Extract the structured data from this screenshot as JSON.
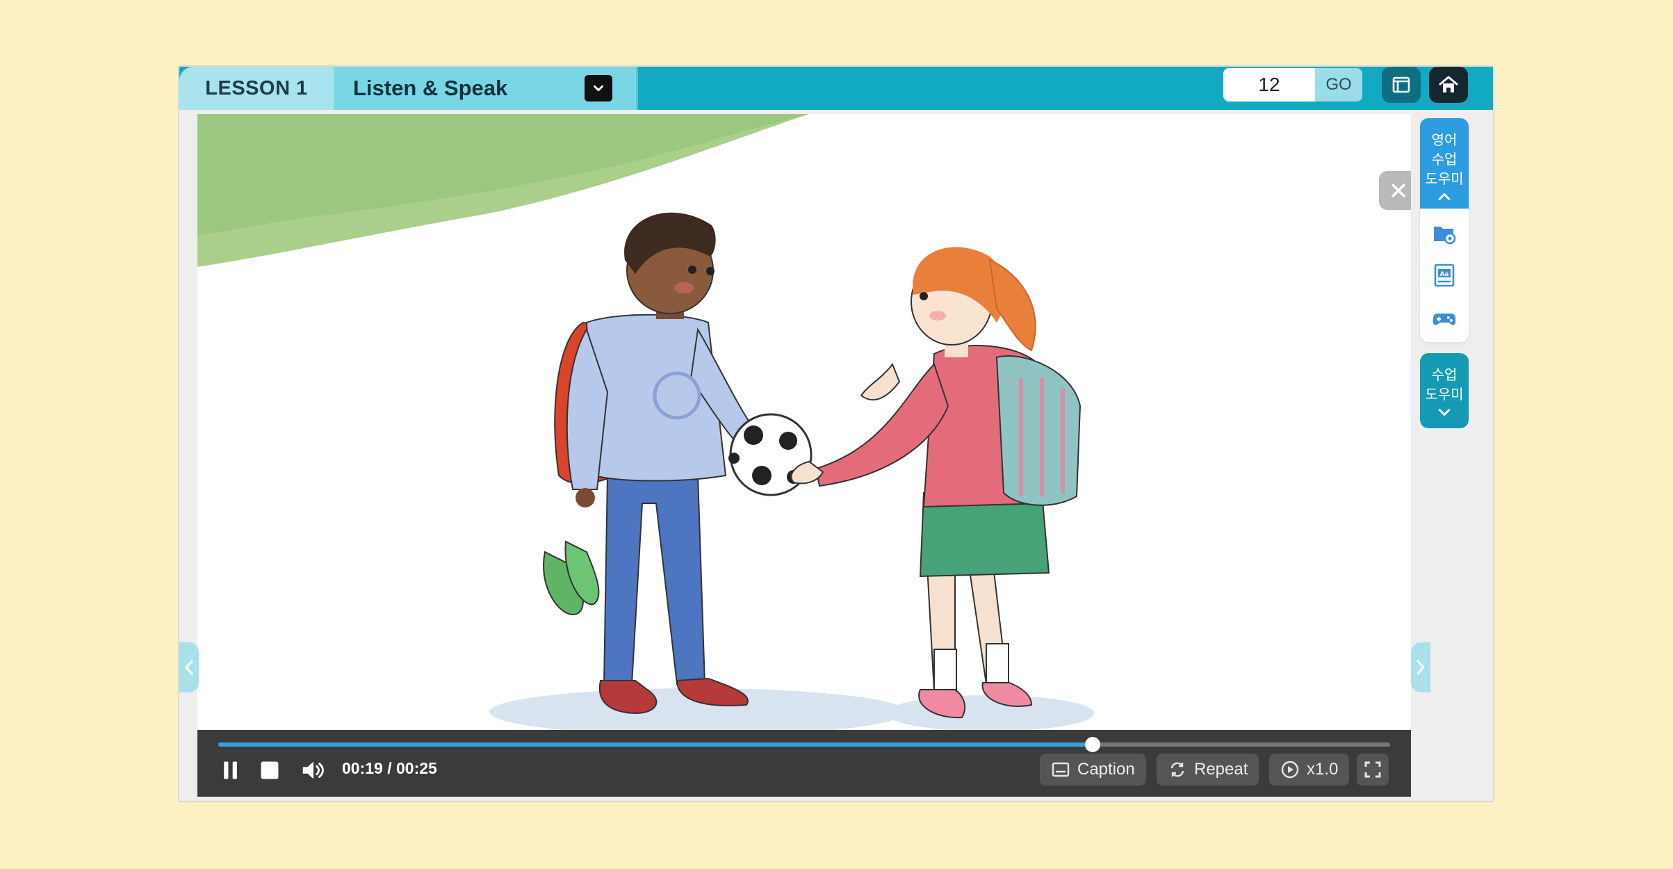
{
  "header": {
    "lesson_label": "LESSON 1",
    "section_title": "Listen & Speak",
    "page_number": "12",
    "go_label": "GO",
    "icons": [
      "dropdown-chevron-icon",
      "book-icon",
      "home-icon"
    ]
  },
  "player": {
    "current_time": "00:19",
    "total_time": "00:25",
    "time_display": "00:19 / 00:25",
    "progress_fraction": 0.746,
    "caption_label": "Caption",
    "repeat_label": "Repeat",
    "speed_label": "x1.0",
    "icons": [
      "pause-icon",
      "stop-icon",
      "volume-icon",
      "caption-icon",
      "repeat-icon",
      "play-speed-icon",
      "fullscreen-icon"
    ]
  },
  "right_panel": {
    "group1_title_lines": [
      "영어",
      "수업",
      "도우미"
    ],
    "group2_title_lines": [
      "수업",
      "도우미"
    ],
    "tools": [
      "folder-settings-icon",
      "dictionary-icon",
      "game-controller-icon"
    ]
  },
  "colors": {
    "background": "#fdf0c2",
    "header": "#12a9c2",
    "lesson_tab": "#a8e4ee",
    "title_tab": "#78d6e5",
    "progress": "#31a3de",
    "controls_bg": "#3b3b3b",
    "tool_blue": "#2d9be0",
    "tool_teal": "#149ab2"
  }
}
